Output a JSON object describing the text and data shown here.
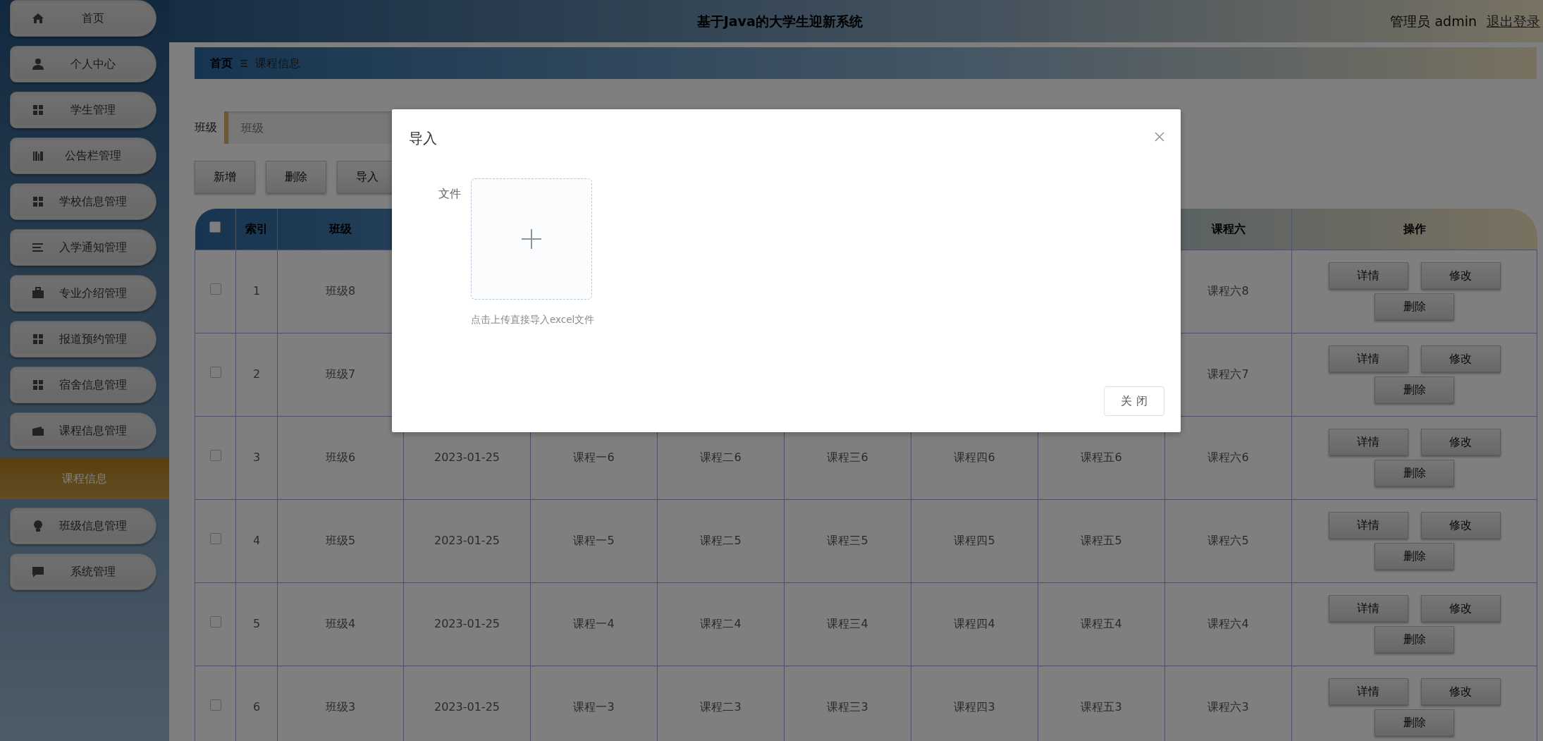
{
  "header": {
    "title": "基于Java的大学生迎新系统",
    "user": "管理员 admin",
    "logout": "退出登录"
  },
  "sidebar": {
    "items": [
      {
        "label": "首页",
        "kind": "menu",
        "selected": false
      },
      {
        "label": "个人中心",
        "kind": "menu",
        "selected": false
      },
      {
        "label": "学生管理",
        "kind": "menu",
        "selected": false
      },
      {
        "label": "公告栏管理",
        "kind": "menu",
        "selected": false
      },
      {
        "label": "学校信息管理",
        "kind": "menu",
        "selected": false
      },
      {
        "label": "入学通知管理",
        "kind": "menu",
        "selected": false
      },
      {
        "label": "专业介绍管理",
        "kind": "menu",
        "selected": false
      },
      {
        "label": "报道预约管理",
        "kind": "menu",
        "selected": false
      },
      {
        "label": "宿舍信息管理",
        "kind": "menu",
        "selected": false
      },
      {
        "label": "课程信息管理",
        "kind": "menu",
        "selected": false
      },
      {
        "label": "课程信息",
        "kind": "submenu",
        "selected": true
      },
      {
        "label": "班级信息管理",
        "kind": "menu",
        "selected": false
      },
      {
        "label": "系统管理",
        "kind": "menu",
        "selected": false
      }
    ]
  },
  "breadcrumb": [
    "首页",
    "课程信息"
  ],
  "search": {
    "label": "班级",
    "placeholder": "班级"
  },
  "toolbar": [
    "新增",
    "删除",
    "导入"
  ],
  "table": {
    "header_checked": false,
    "columns": [
      "索引",
      "班级",
      null,
      null,
      null,
      null,
      null,
      null,
      "课程六",
      "操作"
    ],
    "rows": [
      {
        "checked": false,
        "cells": [
          "1",
          "班级8",
          null,
          null,
          null,
          null,
          null,
          null,
          "课程六8"
        ],
        "actions": [
          "详情",
          "修改",
          "删除"
        ]
      },
      {
        "checked": false,
        "cells": [
          "2",
          "班级7",
          null,
          null,
          null,
          null,
          null,
          null,
          "课程六7"
        ],
        "actions": [
          "详情",
          "修改",
          "删除"
        ]
      },
      {
        "checked": false,
        "cells": [
          "3",
          "班级6",
          "2023-01-25",
          "课程一6",
          "课程二6",
          "课程三6",
          "课程四6",
          "课程五6",
          "课程六6"
        ],
        "actions": [
          "详情",
          "修改",
          "删除"
        ]
      },
      {
        "checked": false,
        "cells": [
          "4",
          "班级5",
          "2023-01-25",
          "课程一5",
          "课程二5",
          "课程三5",
          "课程四5",
          "课程五5",
          "课程六5"
        ],
        "actions": [
          "详情",
          "修改",
          "删除"
        ]
      },
      {
        "checked": false,
        "cells": [
          "5",
          "班级4",
          "2023-01-25",
          "课程一4",
          "课程二4",
          "课程三4",
          "课程四4",
          "课程五4",
          "课程六4"
        ],
        "actions": [
          "详情",
          "修改",
          "删除"
        ]
      },
      {
        "checked": false,
        "cells": [
          "6",
          "班级3",
          "2023-01-25",
          "课程一3",
          "课程二3",
          "课程三3",
          "课程四3",
          "课程五3",
          "课程六3"
        ],
        "actions": [
          "详情",
          "修改",
          "删除"
        ]
      }
    ]
  },
  "dialog": {
    "title": "导入",
    "field_label": "文件",
    "hint": "点击上传直接导入excel文件",
    "button": "关 闭"
  }
}
